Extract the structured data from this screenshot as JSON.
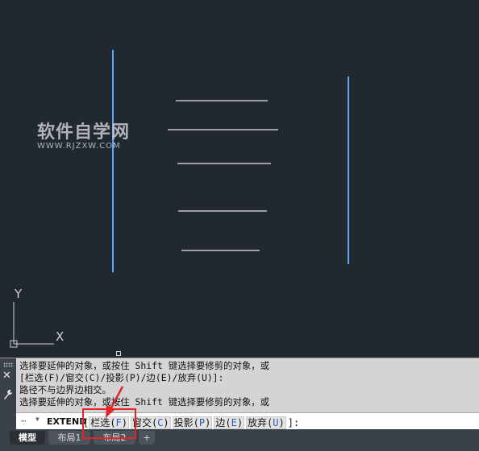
{
  "watermark": {
    "title": "软件自学网",
    "url": "WWW.RJZXW.COM"
  },
  "ucs": {
    "y_label": "Y",
    "x_label": "X"
  },
  "command_history": [
    "选择要延伸的对象，或按住 Shift 键选择要修剪的对象，或",
    "[栏选(F)/窗交(C)/投影(P)/边(E)/放弃(U)]:",
    "路径不与边界边相交。",
    "选择要延伸的对象，或按住 Shift 键选择要修剪的对象，或"
  ],
  "command_line": {
    "command": "EXTEND",
    "open_bracket": "[",
    "options": [
      {
        "label": "栏选(",
        "key": "F",
        "close": ")"
      },
      {
        "label": "窗交(",
        "key": "C",
        "close": ")"
      },
      {
        "label": "投影(",
        "key": "P",
        "close": ")"
      },
      {
        "label": "边(",
        "key": "E",
        "close": ")"
      },
      {
        "label": "放弃(",
        "key": "U",
        "close": ")"
      }
    ],
    "close_bracket": "]:"
  },
  "tabs": [
    "模型",
    "布局1",
    "布局2",
    "+"
  ],
  "colors": {
    "canvas": "#212830",
    "boundary_line": "#5aa7ff",
    "highlight": "#e0262a"
  },
  "icons": [
    "close-icon",
    "wrench-icon",
    "command-prompt-icon",
    "arrow-annotation-icon"
  ]
}
